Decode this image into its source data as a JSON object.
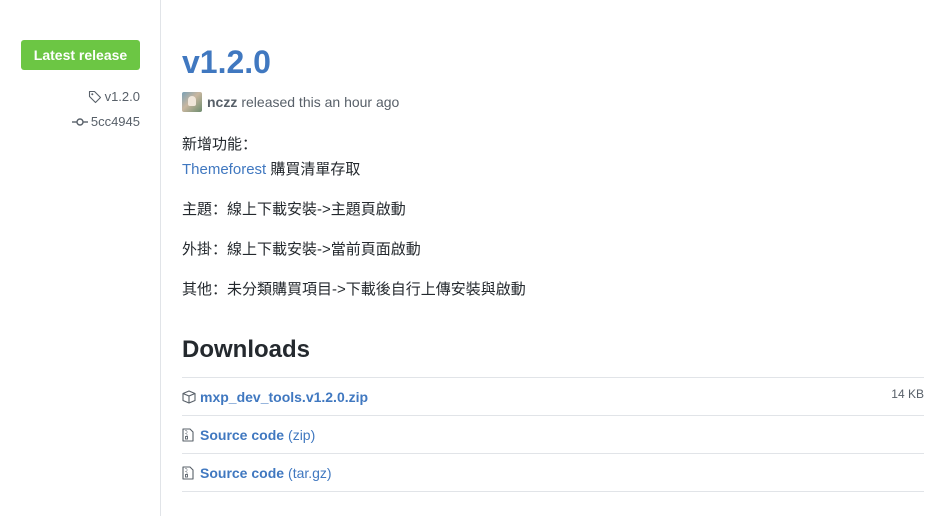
{
  "sidebar": {
    "badge_label": "Latest release",
    "tag": "v1.2.0",
    "commit": "5cc4945"
  },
  "release": {
    "title": "v1.2.0",
    "author": "nczz",
    "released_text": "released this an hour ago"
  },
  "notes": {
    "line1": "新增功能：",
    "line2_link": "Themeforest",
    "line2_rest": " 購買清單存取",
    "line3": "主題：線上下載安裝->主題頁啟動",
    "line4": "外掛：線上下載安裝->當前頁面啟動",
    "line5": "其他：未分類購買項目->下載後自行上傳安裝與啟動"
  },
  "downloads": {
    "title": "Downloads",
    "items": [
      {
        "name": "mxp_dev_tools.v1.2.0.zip",
        "ext": "",
        "size": "14 KB",
        "icon": "package-icon"
      },
      {
        "name": "Source code",
        "ext": "(zip)",
        "size": "",
        "icon": "file-zip-icon"
      },
      {
        "name": "Source code",
        "ext": "(tar.gz)",
        "size": "",
        "icon": "file-zip-icon"
      }
    ]
  },
  "colors": {
    "badge": "#6cc644",
    "link": "#4078c0",
    "muted": "#586069",
    "border": "#e1e4e8"
  }
}
